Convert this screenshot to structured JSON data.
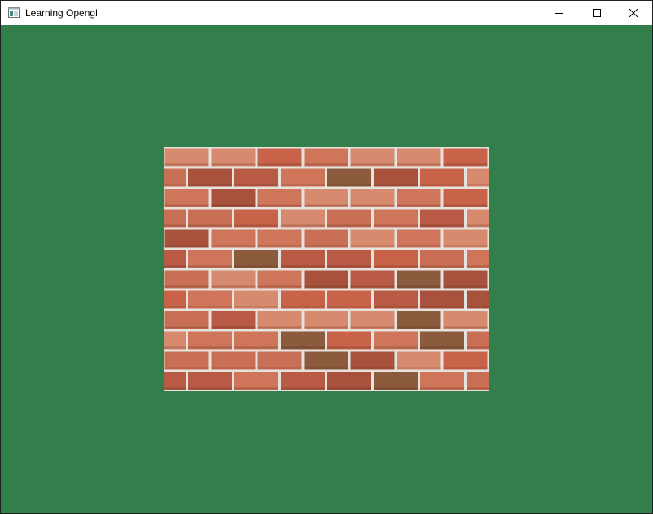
{
  "window": {
    "title": "Learning Opengl",
    "icon": "app-window-icon",
    "controls": [
      "minimize-icon",
      "maximize-icon",
      "close-icon"
    ]
  },
  "viewport": {
    "clear_color": "#337f4c",
    "texture": "brick-wall",
    "mortar_color": "#e6e3de",
    "brick_colors": [
      "#c8634a",
      "#cf7559",
      "#b85a44",
      "#d88a6e",
      "#a8523e",
      "#8c5a3c",
      "#c96f55"
    ]
  }
}
